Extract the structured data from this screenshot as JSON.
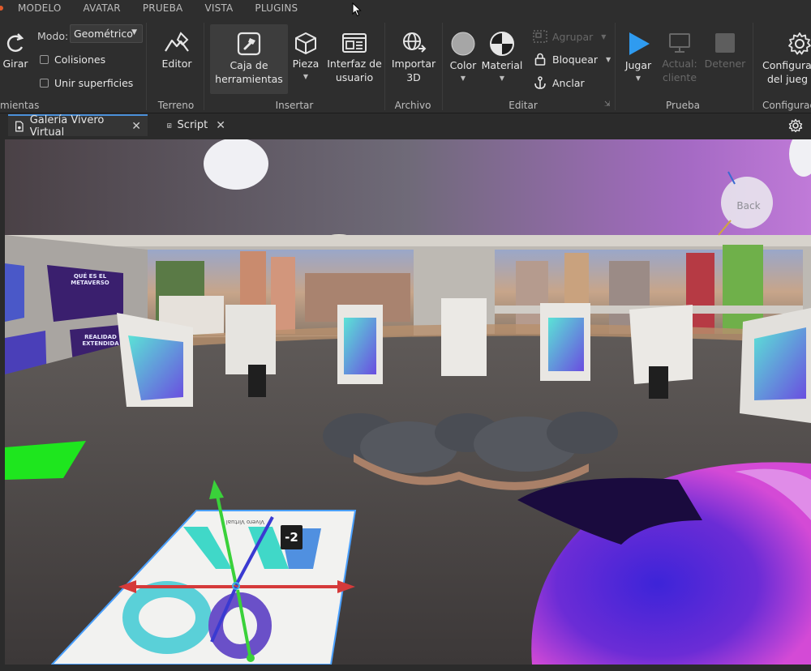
{
  "menu": [
    "MODELO",
    "AVATAR",
    "PRUEBA",
    "VISTA",
    "PLUGINS"
  ],
  "ribbon": {
    "herramientas": {
      "girar_label": "Girar",
      "mode_label": "Modo:",
      "mode_value": "Geométrico",
      "colisiones_label": "Colisiones",
      "unir_label": "Unir superficies",
      "group_label": "mientas"
    },
    "terreno": {
      "editor_label": "Editor",
      "group_label": "Terreno"
    },
    "insertar": {
      "caja_label_1": "Caja de",
      "caja_label_2": "herramientas",
      "pieza_label": "Pieza",
      "interfaz_label_1": "Interfaz de",
      "interfaz_label_2": "usuario",
      "group_label": "Insertar"
    },
    "archivo": {
      "importar_label_1": "Importar",
      "importar_label_2": "3D",
      "group_label": "Archivo"
    },
    "editar": {
      "color_label": "Color",
      "material_label": "Material",
      "agrupar_label": "Agrupar",
      "bloquear_label": "Bloquear",
      "anclar_label": "Anclar",
      "group_label": "Editar"
    },
    "prueba": {
      "jugar_label": "Jugar",
      "actual_label_1": "Actual:",
      "actual_label_2": "cliente",
      "detener_label": "Detener",
      "group_label": "Prueba"
    },
    "config": {
      "config_label_1": "Configura",
      "config_label_2": "del jueg",
      "group_label": "Configuraci"
    }
  },
  "tabs": [
    {
      "label": "Galería Vivero Virtual"
    },
    {
      "label": "Script"
    }
  ],
  "viewport": {
    "move_value": "-2",
    "back_label": "Back",
    "mural_1": "QUÉ ES EL METAVERSO",
    "mural_2": "REALIDAD EXTENDIDA"
  },
  "colors": {
    "accent": "#4a90d9",
    "play": "#2f9bf0",
    "x_axis": "#d53a3a",
    "y_axis": "#3ad13a",
    "z_axis": "#3a3ad1"
  }
}
